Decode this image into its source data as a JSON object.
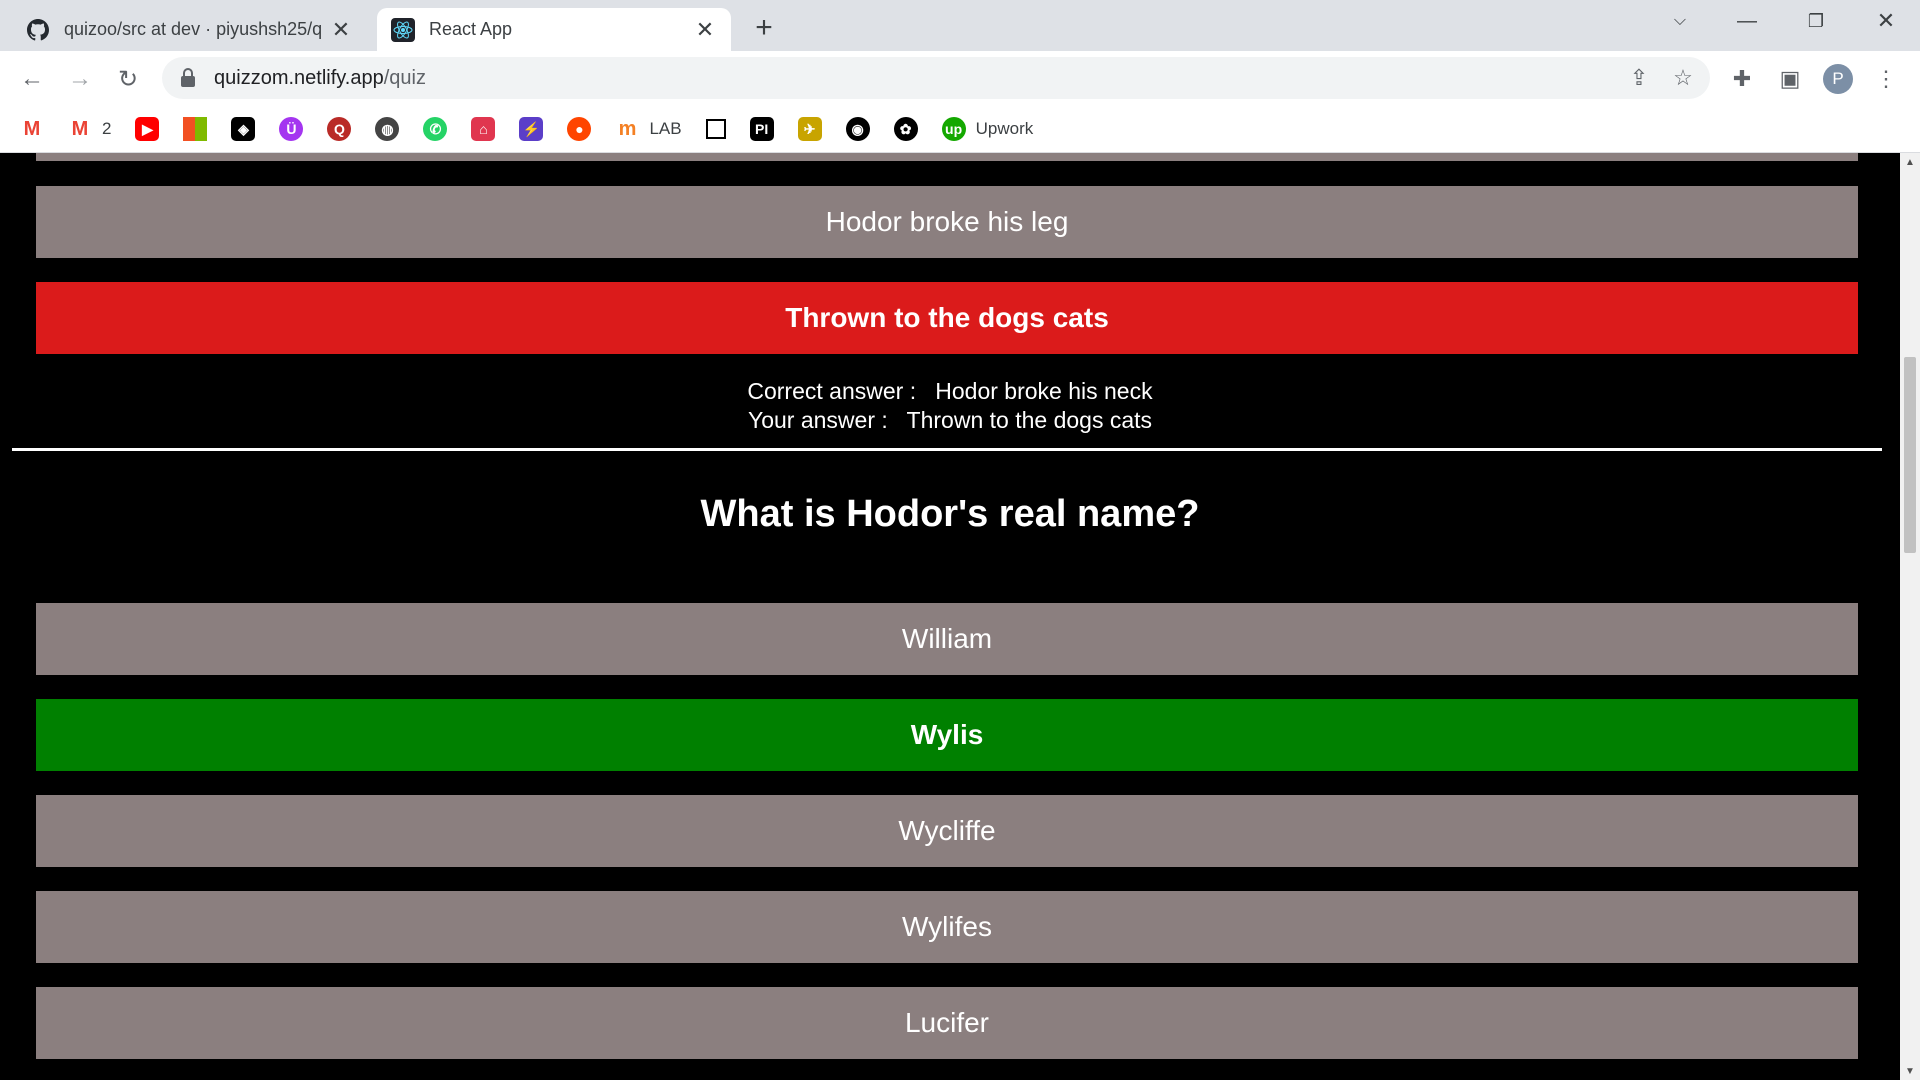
{
  "browser": {
    "tabs": [
      {
        "title": "quizoo/src at dev · piyushsh25/q",
        "icon": "github-icon"
      },
      {
        "title": "React App",
        "icon": "react-icon"
      }
    ],
    "url_host": "quizzom.netlify.app",
    "url_path": "/quiz",
    "profile_initial": "P",
    "bookmarks": [
      {
        "icon": "gmail-icon",
        "label": "",
        "color": "#ea4335"
      },
      {
        "icon": "gmail-icon",
        "label": "2",
        "color": "#ea4335"
      },
      {
        "icon": "youtube-icon",
        "label": "",
        "color": "#ff0000"
      },
      {
        "icon": "microsoft-icon",
        "label": "",
        "color": "#f25022"
      },
      {
        "icon": "codepen-icon",
        "label": "",
        "color": "#000000"
      },
      {
        "icon": "udemy-icon",
        "label": "",
        "color": "#a435f0"
      },
      {
        "icon": "quora-icon",
        "label": "",
        "color": "#b92b27"
      },
      {
        "icon": "globe-icon",
        "label": "",
        "color": "#444444"
      },
      {
        "icon": "whatsapp-icon",
        "label": "",
        "color": "#25d366"
      },
      {
        "icon": "app-icon",
        "label": "",
        "color": "#e0364f"
      },
      {
        "icon": "bolt-icon",
        "label": "",
        "color": "#5b3ec8"
      },
      {
        "icon": "reddit-icon",
        "label": "",
        "color": "#ff4500"
      },
      {
        "icon": "lab-icon",
        "label": "LAB",
        "color": "#f48024"
      },
      {
        "icon": "square-icon",
        "label": "",
        "color": "#000000"
      },
      {
        "icon": "pi-icon",
        "label": "",
        "color": "#000000"
      },
      {
        "icon": "bird-icon",
        "label": "",
        "color": "#c8a400"
      },
      {
        "icon": "github-icon",
        "label": "",
        "color": "#000000"
      },
      {
        "icon": "openai-icon",
        "label": "",
        "color": "#000000"
      },
      {
        "icon": "upwork-icon",
        "label": "Upwork",
        "color": "#14a800"
      }
    ]
  },
  "quiz": {
    "prev_options": [
      {
        "text": "Hodor broke his leg",
        "state": "neutral"
      },
      {
        "text": "Thrown to the dogs cats",
        "state": "wrong"
      }
    ],
    "correct_answer_label": "Correct answer :",
    "correct_answer": "Hodor broke his neck",
    "your_answer_label": "Your answer :",
    "your_answer": "Thrown to the dogs cats",
    "question": "What is Hodor's real name?",
    "options": [
      {
        "text": "William",
        "state": "neutral"
      },
      {
        "text": "Wylis",
        "state": "correct"
      },
      {
        "text": "Wycliffe",
        "state": "neutral"
      },
      {
        "text": "Wylifes",
        "state": "neutral"
      },
      {
        "text": "Lucifer",
        "state": "neutral"
      }
    ],
    "colors": {
      "neutral": "#8b7f7f",
      "wrong": "#db1b1b",
      "correct": "#008000"
    }
  }
}
